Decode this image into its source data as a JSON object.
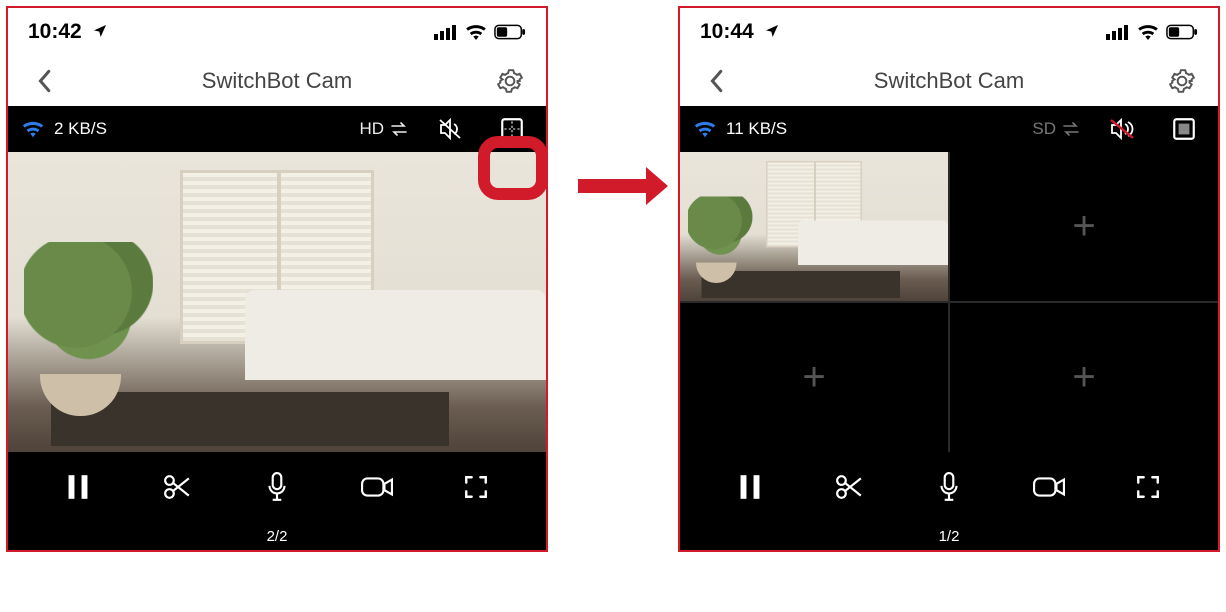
{
  "left": {
    "time": "10:42",
    "title": "SwitchBot Cam",
    "speed": "2 KB/S",
    "quality": "HD",
    "page_indicator": "2/2"
  },
  "right": {
    "time": "10:44",
    "title": "SwitchBot Cam",
    "speed": "11 KB/S",
    "quality": "SD",
    "page_indicator": "1/2"
  }
}
